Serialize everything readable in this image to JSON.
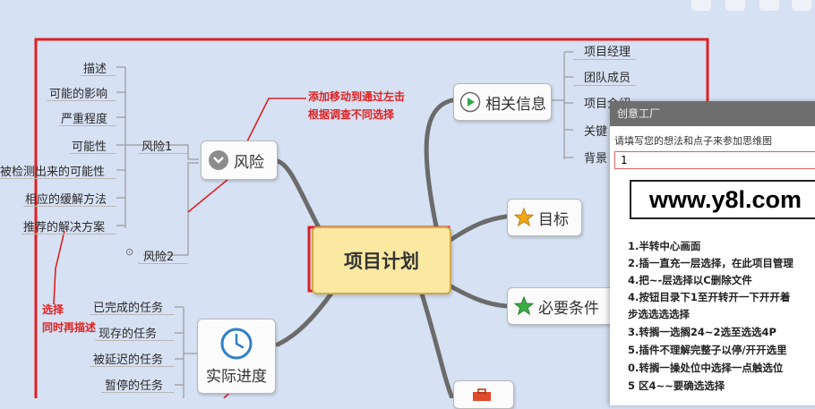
{
  "center": "项目计划",
  "nodes": {
    "risk": "风险",
    "related_info": "相关信息",
    "goal": "目标",
    "required_conditions": "必要条件",
    "actual_progress": "实际进度"
  },
  "risk_children": {
    "risk1": "风险1",
    "risk2": "风险2",
    "risk2_marker": "⊙",
    "risk1_items": [
      "描述",
      "可能的影响",
      "严重程度",
      "可能性",
      "被检测出来的可能性",
      "相应的缓解方法",
      "推荐的解决方案"
    ]
  },
  "related_children": [
    "项目经理",
    "团队成员",
    "项目介绍",
    "关键",
    "背景"
  ],
  "progress_children": [
    "已完成的任务",
    "现存的任务",
    "被延迟的任务",
    "暂停的任务"
  ],
  "annotations": {
    "top": [
      "添加移动到通过左击",
      "根据调查不同选择"
    ],
    "left": [
      "选择",
      "同时再描述"
    ]
  },
  "panel": {
    "title": "创意工厂",
    "subtitle": "请填写您的想法和点子来参加思维图",
    "input_value": "1",
    "url": "www.y8l.com",
    "lines": [
      "1.半转中心画面",
      "2.插一直充一层选择，在此项目管理",
      "4.把~-层选择以C删除文件",
      "4.按钮目录下1至开转开一下开开着",
      "步选选选选择",
      "3.转搁一选搁24~2选至选选4P",
      "5.插件不理解完整子以停/开开选里",
      "0.转搁一操处位中选择一点触选位",
      "5 区4~~要确选选择"
    ]
  },
  "colors": {
    "background": "#d6e1f3",
    "frame_red": "#e02020",
    "branch": "#6b6b6b",
    "center_fill": "#fbe8a1"
  }
}
